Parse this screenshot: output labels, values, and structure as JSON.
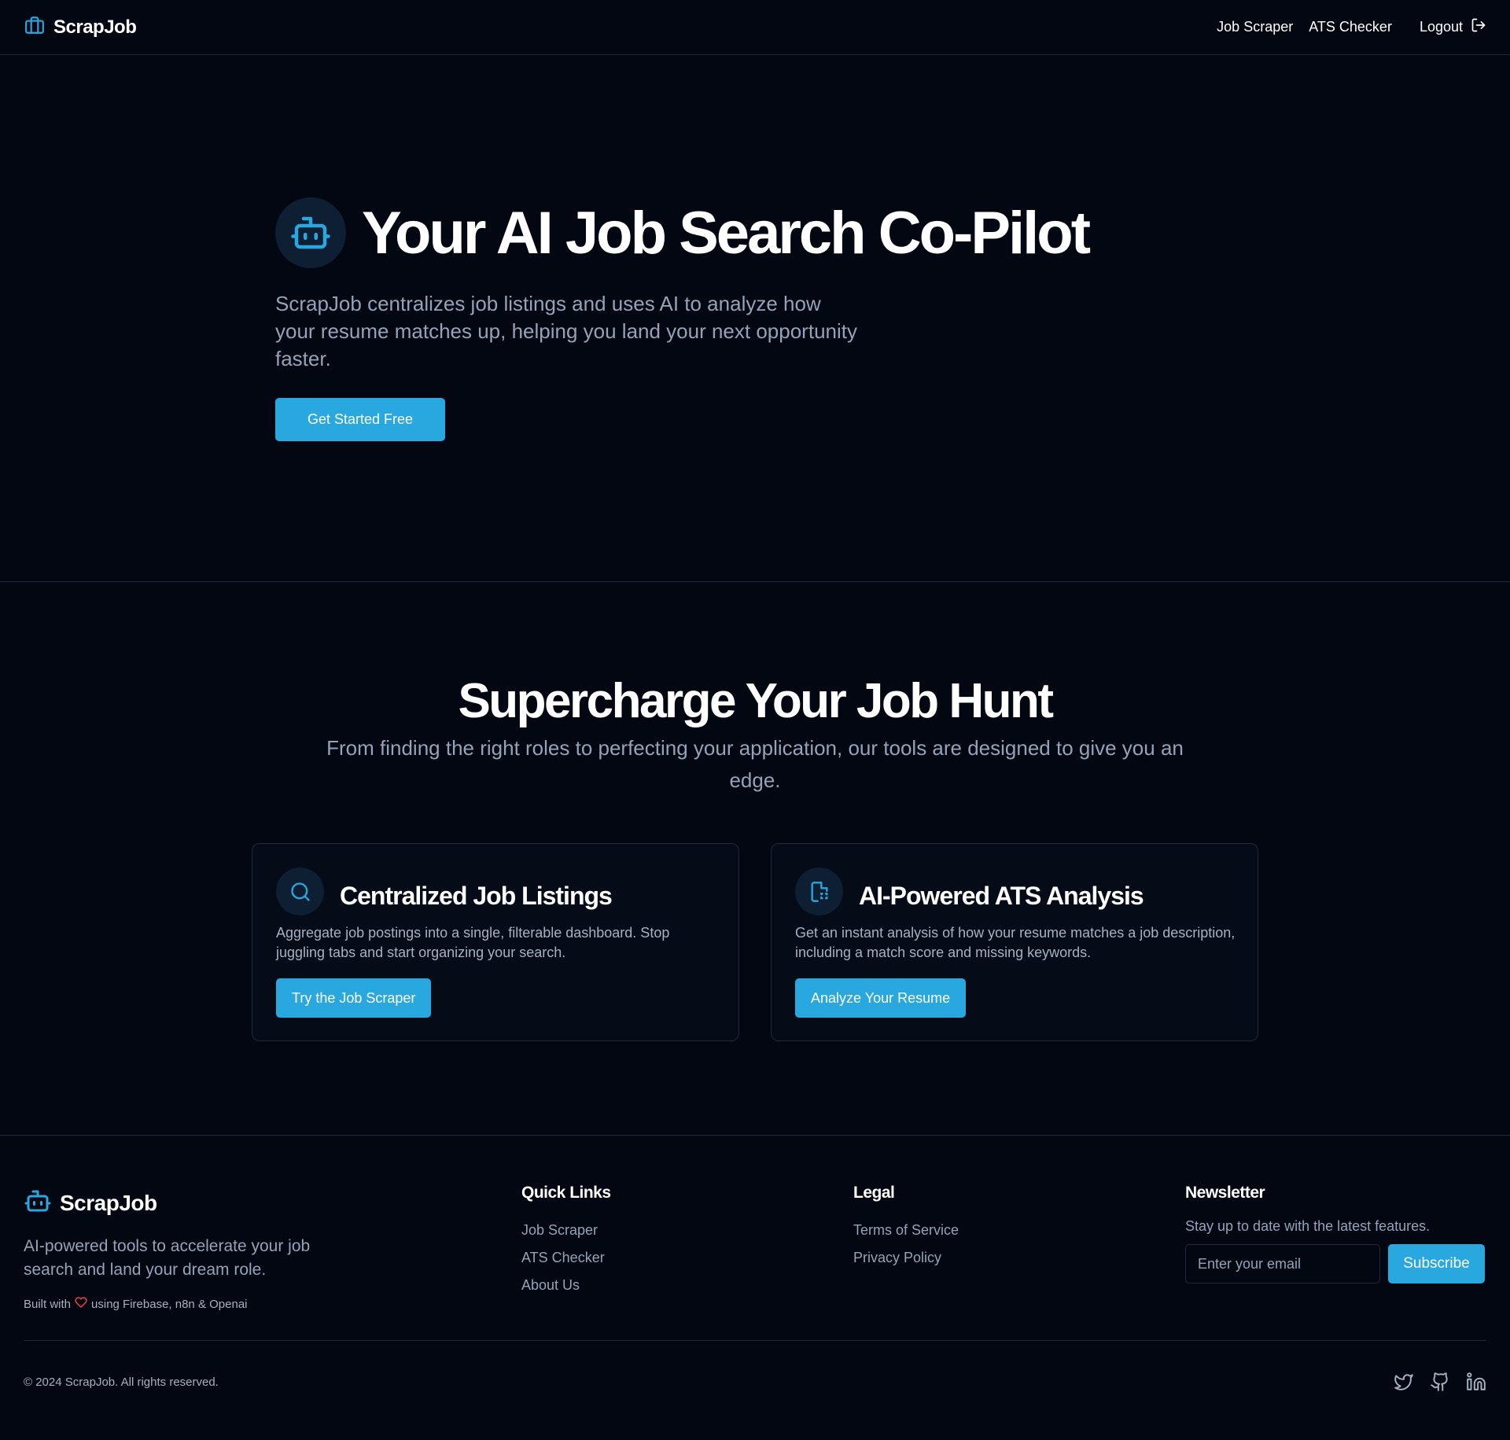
{
  "header": {
    "brand": "ScrapJob",
    "nav": {
      "job_scraper": "Job Scraper",
      "ats_checker": "ATS Checker",
      "logout": "Logout"
    }
  },
  "hero": {
    "title": "Your AI Job Search Co-Pilot",
    "subtitle": "ScrapJob centralizes job listings and uses AI to analyze how your resume matches up, helping you land your next opportunity faster.",
    "cta": "Get Started Free"
  },
  "features": {
    "title": "Supercharge Your Job Hunt",
    "subtitle": "From finding the right roles to perfecting your application, our tools are designed to give you an edge.",
    "cards": [
      {
        "icon": "search-icon",
        "title": "Centralized Job Listings",
        "description": "Aggregate job postings into a single, filterable dashboard. Stop juggling tabs and start organizing your search.",
        "button": "Try the Job Scraper"
      },
      {
        "icon": "file-scan-icon",
        "title": "AI-Powered ATS Analysis",
        "description": "Get an instant analysis of how your resume matches a job description, including a match score and missing keywords.",
        "button": "Analyze Your Resume"
      }
    ]
  },
  "footer": {
    "brand": "ScrapJob",
    "tagline": "AI-powered tools to accelerate your job search and land your dream role.",
    "built_prefix": "Built with",
    "built_suffix": "using Firebase, n8n & Openai",
    "quick_links": {
      "heading": "Quick Links",
      "items": [
        "Job Scraper",
        "ATS Checker",
        "About Us"
      ]
    },
    "legal": {
      "heading": "Legal",
      "items": [
        "Terms of Service",
        "Privacy Policy"
      ]
    },
    "newsletter": {
      "heading": "Newsletter",
      "text": "Stay up to date with the latest features.",
      "placeholder": "Enter your email",
      "button": "Subscribe"
    },
    "copyright": "© 2024 ScrapJob. All rights reserved.",
    "social": [
      "twitter-icon",
      "github-icon",
      "linkedin-icon"
    ]
  },
  "colors": {
    "accent": "#29a8e0",
    "background": "#030712",
    "muted": "#94a3b8",
    "border": "#1e293b"
  }
}
